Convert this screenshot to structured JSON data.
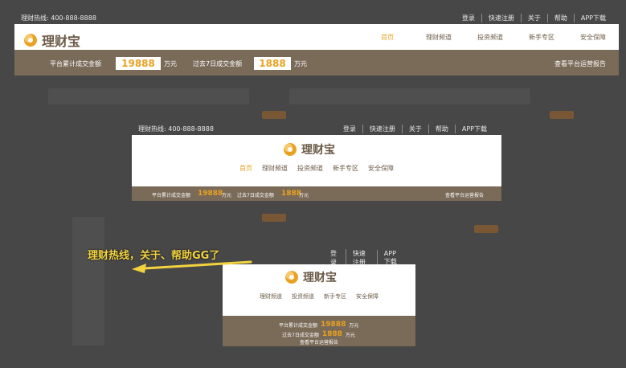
{
  "top": {
    "hotline": "理财热线: 400-888-8888",
    "links": [
      "登录",
      "快速注册",
      "关于",
      "帮助",
      "APP下载"
    ]
  },
  "logo": {
    "text": "理财宝",
    "icon": "coin-logo-icon"
  },
  "nav": [
    "首页",
    "理财频道",
    "投资频道",
    "新手专区",
    "安全保障"
  ],
  "stats": {
    "total_label": "平台累计成交金额",
    "total_value": "19888",
    "unit": "万元",
    "week_label": "过去7日成交金额",
    "week_value": "1888",
    "report": "查看平台运营报告"
  },
  "small_top_links": [
    "登录",
    "快速注册",
    "APP下载"
  ],
  "small_nav": [
    "理财频道",
    "投资频道",
    "新手专区",
    "安全保障"
  ],
  "annotation": "理财热线，关于、帮助GG了",
  "colors": {
    "accent": "#e9a121",
    "stats_bg": "#7a6a58",
    "annotation": "#f2d33f"
  }
}
